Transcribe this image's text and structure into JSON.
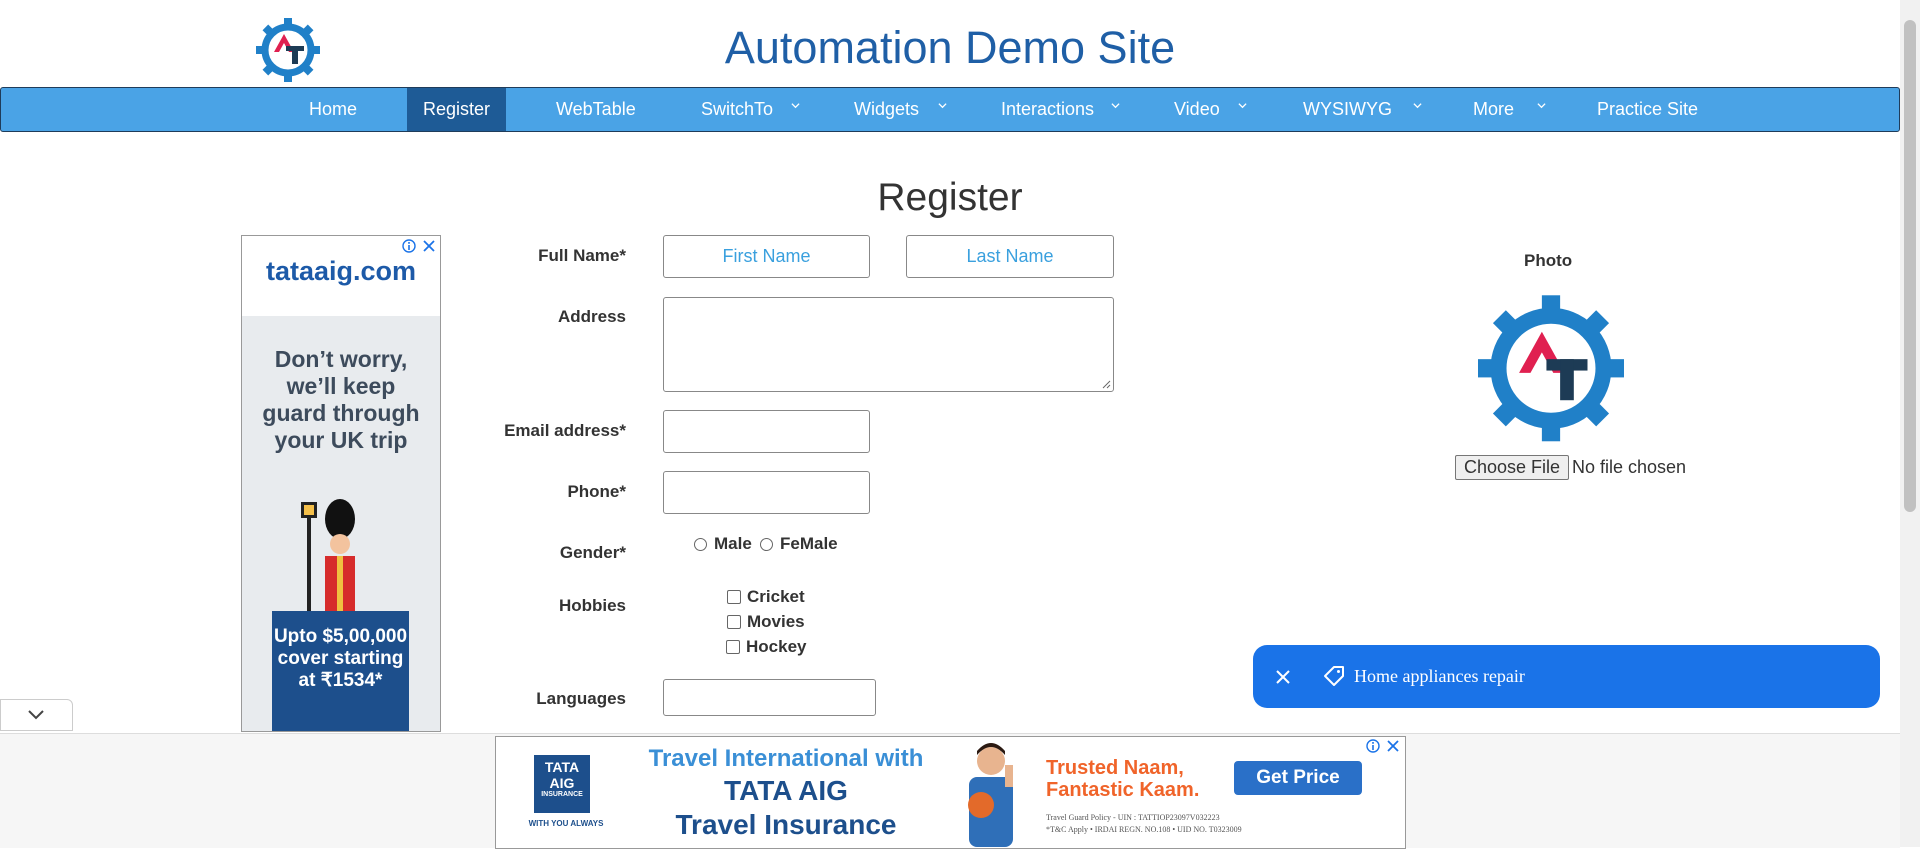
{
  "site_title": "Automation Demo Site",
  "logo": {
    "letters": "AT"
  },
  "nav": {
    "items": [
      {
        "label": "Home"
      },
      {
        "label": "Register"
      },
      {
        "label": "WebTable"
      },
      {
        "label": "SwitchTo"
      },
      {
        "label": "Widgets"
      },
      {
        "label": "Interactions"
      },
      {
        "label": "Video"
      },
      {
        "label": "WYSIWYG"
      },
      {
        "label": "More"
      },
      {
        "label": "Practice Site"
      }
    ]
  },
  "page_title": "Register",
  "form": {
    "full_name_label": "Full Name*",
    "first_name_placeholder": "First Name",
    "last_name_placeholder": "Last Name",
    "address_label": "Address",
    "email_label": "Email address*",
    "phone_label": "Phone*",
    "gender_label": "Gender*",
    "gender_options": [
      "Male",
      "FeMale"
    ],
    "hobbies_label": "Hobbies",
    "hobbies_options": [
      "Cricket",
      "Movies",
      "Hockey"
    ],
    "languages_label": "Languages"
  },
  "photo": {
    "label": "Photo",
    "choose_file_label": "Choose File",
    "no_file_text": "No file chosen"
  },
  "left_ad": {
    "brand": "tataaig.com",
    "headline": "Don’t worry, we’ll keep guard through your UK trip",
    "offer": "Upto $5,00,000 cover starting at ₹1534*"
  },
  "bottom_ad": {
    "logo_line1": "TATA",
    "logo_line2": "AIG",
    "logo_line3": "INSURANCE",
    "logo_tag": "WITH YOU ALWAYS",
    "line1": "Travel International with",
    "line2": "TATA AIG",
    "line3": "Travel Insurance",
    "slogan1": "Trusted Naam,",
    "slogan2": "Fantastic Kaam.",
    "cta": "Get Price",
    "fine1": "Travel Guard Policy - UIN : TATTIOP23097V032223",
    "fine2": "*T&C Apply  •  IRDAI REGN. NO.108  •  UID NO. T0323009"
  },
  "toast": {
    "text": "Home appliances repair"
  },
  "colors": {
    "nav_bg": "#4aa3e6",
    "nav_active": "#1e5b96",
    "title": "#1f5fa6",
    "toast": "#1a73e8",
    "placeholder": "#3aa0de"
  }
}
